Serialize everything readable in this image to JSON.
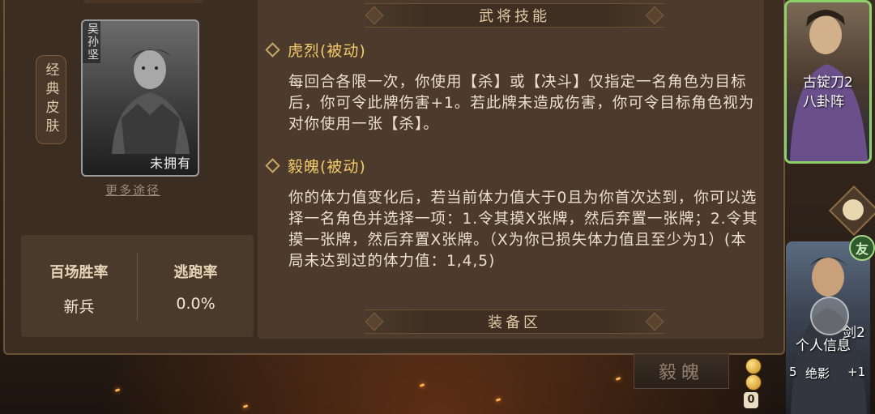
{
  "general_card": {
    "name_vertical": "吴孙坚",
    "status": "未拥有",
    "more_ways_link": "更多途径",
    "classic_skin_tab": "经典皮肤"
  },
  "stats": {
    "win_rate_label": "百场胜率",
    "win_rate_value": "新兵",
    "escape_rate_label": "逃跑率",
    "escape_rate_value": "0.0%"
  },
  "info_panel": {
    "skills_banner": "武将技能",
    "equipment_banner": "装备区",
    "skills": [
      {
        "title": "虎烈(被动)",
        "description": "每回合各限一次，你使用【杀】或【决斗】仅指定一名角色为目标后，你可令此牌伤害+1。若此牌未造成伤害，你可令目标角色视为对你使用一张【杀】。"
      },
      {
        "title": "毅魄(被动)",
        "description": "你的体力值变化后，若当前体力值大于0且为你首次达到，你可以选择一名角色并选择一项：1.令其摸X张牌，然后弃置一张牌；2.令其摸一张牌，然后弃置X张牌。（X为你已损失体力值且至少为1）(本局未达到过的体力值：1,4,5)"
      }
    ]
  },
  "right_heroes": {
    "top_equipment_1": "古锭刀2",
    "top_equipment_2": "八卦阵",
    "friend_badge": "友",
    "personal_info": "个人信息",
    "bottom_equipment": "剑2",
    "bottom_card_name": "绝影",
    "bottom_card_value": "5",
    "bottom_card_plus": "+1",
    "zero_badge": "0"
  },
  "skill_button": "毅魄",
  "colors": {
    "accent_gold": "#f2c96a",
    "active_border": "#8ed06a",
    "panel_bg": "#4c3b2c"
  }
}
